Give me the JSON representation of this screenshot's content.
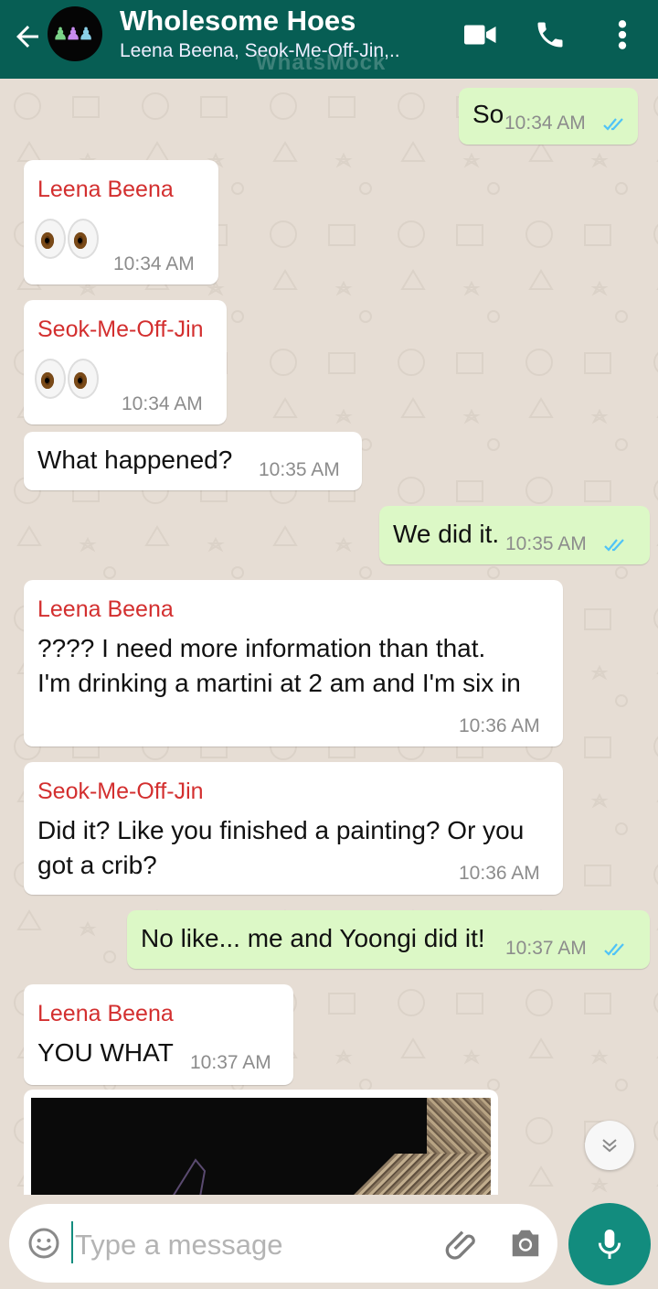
{
  "header": {
    "title": "Wholesome Hoes",
    "members": "Leena Beena, Seok-Me-Off-Jin,..",
    "watermark": "WhatsMock",
    "icons": [
      "back-arrow-icon",
      "video-call-icon",
      "phone-icon",
      "more-vert-icon"
    ]
  },
  "messages": [
    {
      "side": "out",
      "text": "So",
      "time": "10:34 AM",
      "ticks": "read"
    },
    {
      "side": "in",
      "sender": "Leena Beena",
      "text": "👀",
      "time": "10:34 AM"
    },
    {
      "side": "in",
      "sender": "Seok-Me-Off-Jin",
      "text": "👀",
      "time": "10:34 AM"
    },
    {
      "side": "in",
      "text": "What happened?",
      "time": "10:35 AM"
    },
    {
      "side": "out",
      "text": "We did it.",
      "time": "10:35 AM",
      "ticks": "read"
    },
    {
      "side": "in",
      "sender": "Leena Beena",
      "lines": [
        "???? I need more information than that.",
        "I'm drinking a martini at 2 am and I'm six in"
      ],
      "time": "10:36 AM"
    },
    {
      "side": "in",
      "sender": "Seok-Me-Off-Jin",
      "lines": [
        "Did it? Like you finished a painting? Or you",
        "got a crib?"
      ],
      "time": "10:36 AM"
    },
    {
      "side": "out",
      "text": "No like... me and Yoongi did it!",
      "time": "10:37 AM",
      "ticks": "read"
    },
    {
      "side": "in",
      "sender": "Leena Beena",
      "text": "YOU WHAT",
      "time": "10:37 AM"
    }
  ],
  "composer": {
    "placeholder": "Type a message",
    "icons": [
      "emoji-icon",
      "attach-icon",
      "camera-icon",
      "mic-icon"
    ]
  },
  "colors": {
    "header": "#075e54",
    "incoming": "#ffffff",
    "outgoing": "#dcf8c6",
    "sender": "#d32f2f",
    "tick": "#4fc3f7",
    "accent": "#128c7e"
  }
}
